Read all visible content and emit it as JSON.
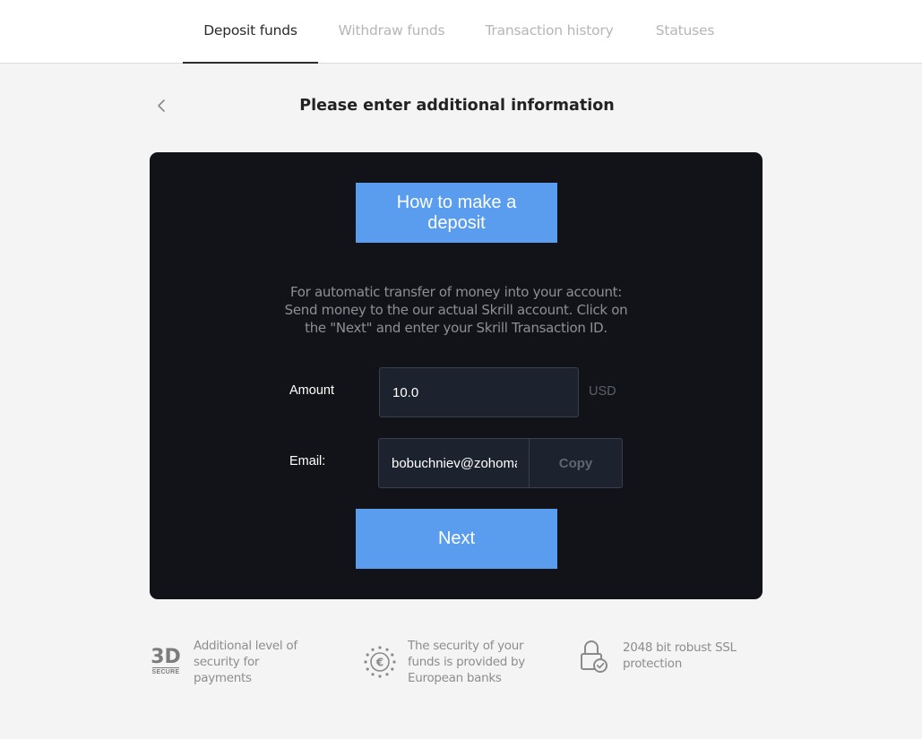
{
  "tabs": [
    {
      "label": "Deposit funds",
      "active": true
    },
    {
      "label": "Withdraw funds",
      "active": false
    },
    {
      "label": "Transaction history",
      "active": false
    },
    {
      "label": "Statuses",
      "active": false
    }
  ],
  "header": {
    "back_icon": "chevron-left-icon",
    "title": "Please enter additional information"
  },
  "panel": {
    "howto_label": "How to make a deposit",
    "info_text": "For automatic transfer of money into your account: Send money to the our actual Skrill account. Click on the \"Next\" and enter your Skrill Transaction ID.",
    "amount": {
      "label": "Amount",
      "value": "10.0",
      "currency": "USD"
    },
    "email": {
      "label": "Email:",
      "value": "bobuchniev@zohomail.eu",
      "copy_label": "Copy"
    },
    "next_label": "Next"
  },
  "features": [
    {
      "icon": "3d-secure-icon",
      "icon_text_big": "3D",
      "icon_text_small": "SECURE",
      "text": "Additional level of security for payments"
    },
    {
      "icon": "euro-stars-icon",
      "text": "The security of your funds is provided by European banks"
    },
    {
      "icon": "lock-check-icon",
      "text": "2048 bit robust SSL protection"
    }
  ],
  "colors": {
    "accent": "#5a9cee",
    "panel_bg": "#111318",
    "page_bg": "#f4f4f4",
    "input_bg": "#1c222e"
  }
}
